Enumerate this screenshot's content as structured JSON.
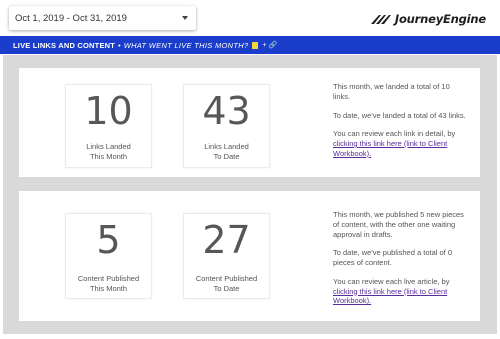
{
  "header": {
    "date_range": "Oct 1, 2019 - Oct 31, 2019",
    "logo_text": "JourneyEngine"
  },
  "banner": {
    "title": "LIVE LINKS AND CONTENT",
    "separator": "•",
    "question": "WHAT WENT LIVE THIS MONTH?",
    "suffix": "+ 🔗"
  },
  "links_section": {
    "stats": [
      {
        "value": "10",
        "label": "Links Landed\nThis Month"
      },
      {
        "value": "43",
        "label": "Links Landed\nTo Date"
      }
    ],
    "description": {
      "p1": "This month, we landed a total of 10 links.",
      "p2": "To date, we've landed a total of 43 links.",
      "p3_prefix": "You can review each link in detail, by ",
      "p3_link": "clicking this link here (link to Client Workbook)."
    }
  },
  "content_section": {
    "stats": [
      {
        "value": "5",
        "label": "Content Published\nThis Month"
      },
      {
        "value": "27",
        "label": "Content Published\nTo Date"
      }
    ],
    "description": {
      "p1": "This month, we published 5 new pieces of content, with the other one waiting approval in drafts.",
      "p2": "To date, we've published a total of 0 pieces of content.",
      "p3_prefix": "You can review each live article, by ",
      "p3_link": "clicking this link here (link to Client Workbook)."
    }
  },
  "colors": {
    "banner_bg": "#1a3ecb",
    "canvas_bg": "#d9d9d9",
    "link": "#5a2d9a"
  }
}
